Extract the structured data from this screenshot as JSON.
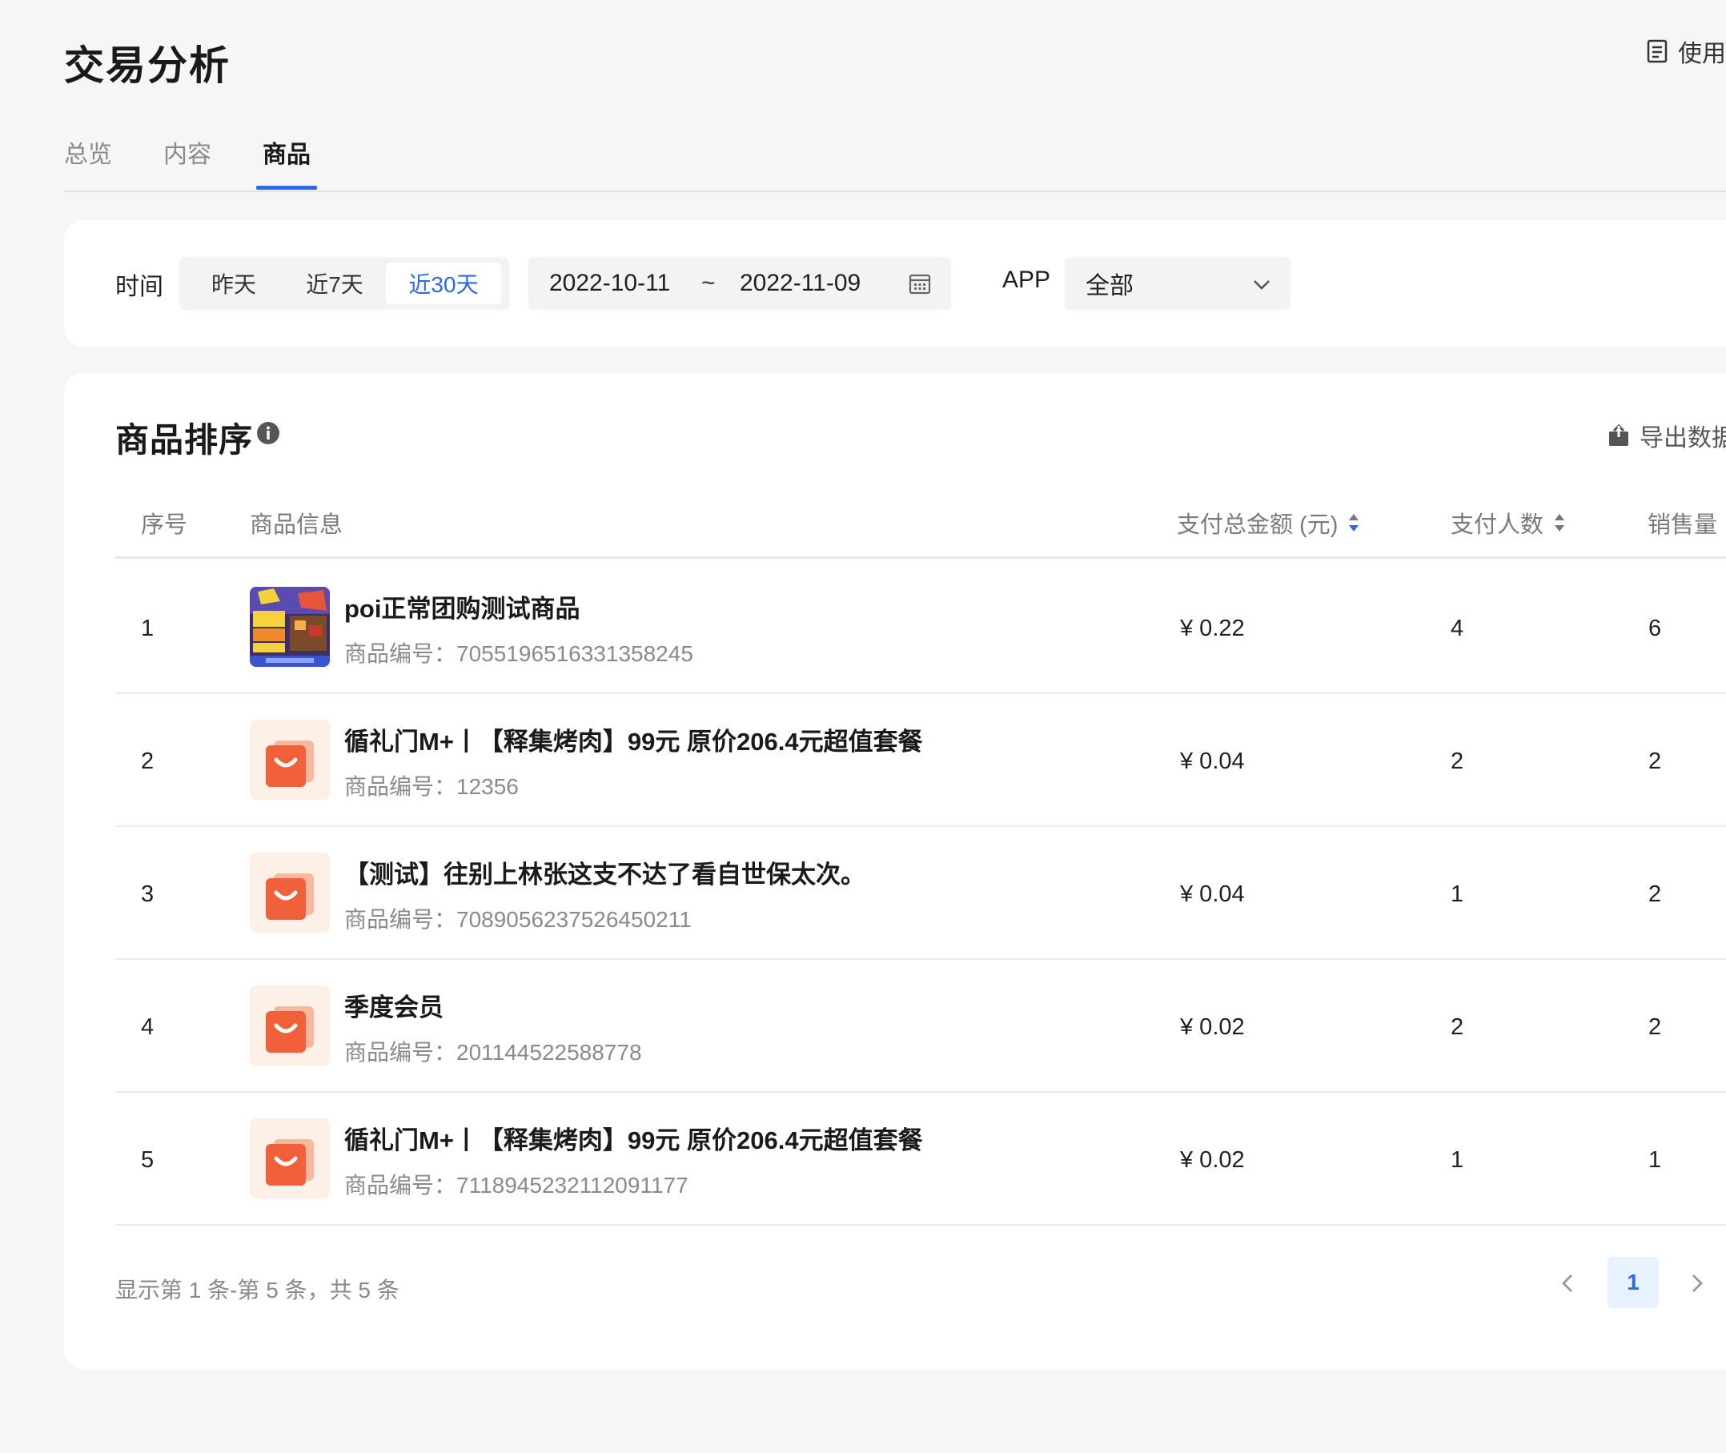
{
  "page": {
    "title": "交易分析",
    "help_label": "使用",
    "tabs": [
      {
        "label": "总览",
        "active": false
      },
      {
        "label": "内容",
        "active": false
      },
      {
        "label": "商品",
        "active": true
      }
    ]
  },
  "filter": {
    "time_label": "时间",
    "ranges": [
      "昨天",
      "近7天",
      "近30天"
    ],
    "selected_range": "近30天",
    "date_start": "2022-10-11",
    "date_separator": "~",
    "date_end": "2022-11-09",
    "app_label": "APP",
    "app_value": "全部"
  },
  "ranking": {
    "title": "商品排序",
    "export_label": "导出数据",
    "columns": {
      "index": "序号",
      "info": "商品信息",
      "amount": "支付总金额 (元)",
      "buyers": "支付人数",
      "sales": "销售量"
    },
    "id_prefix": "商品编号：",
    "rows": [
      {
        "index": "1",
        "name": "poi正常团购测试商品",
        "id": "7055196516331358245",
        "amount": "¥ 0.22",
        "buyers": "4",
        "sales": "6",
        "thumb": "promo-image"
      },
      {
        "index": "2",
        "name": "循礼门M+丨【释集烤肉】99元 原价206.4元超值套餐",
        "id": "12356",
        "amount": "¥ 0.04",
        "buyers": "2",
        "sales": "2",
        "thumb": "shopping-bag-icon"
      },
      {
        "index": "3",
        "name": "【测试】往别上林张这支不达了看自世保太次。",
        "id": "7089056237526450211",
        "amount": "¥ 0.04",
        "buyers": "1",
        "sales": "2",
        "thumb": "shopping-bag-icon"
      },
      {
        "index": "4",
        "name": "季度会员",
        "id": "201144522588778",
        "amount": "¥ 0.02",
        "buyers": "2",
        "sales": "2",
        "thumb": "shopping-bag-icon"
      },
      {
        "index": "5",
        "name": "循礼门M+丨【释集烤肉】99元 原价206.4元超值套餐",
        "id": "7118945232112091177",
        "amount": "¥ 0.02",
        "buyers": "1",
        "sales": "1",
        "thumb": "shopping-bag-icon"
      }
    ],
    "summary": "显示第 1 条-第 5 条，共 5 条",
    "current_page": "1"
  },
  "colors": {
    "accent": "#2d6ae3",
    "background": "#f6f6f6",
    "card": "#ffffff",
    "muted_text": "#8a8a8a",
    "bag_orange": "#f0603a"
  }
}
